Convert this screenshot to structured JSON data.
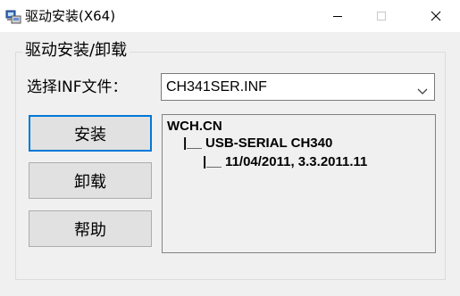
{
  "window": {
    "title": "驱动安装(X64)",
    "app_icon": "computer-setup-icon",
    "controls": [
      "minimize-icon",
      "maximize-icon",
      "close-icon"
    ]
  },
  "group": {
    "title": "驱动安装/卸载"
  },
  "inf_selector": {
    "label": "选择INF文件：",
    "value": "CH341SER.INF",
    "icon": "chevron-down-icon"
  },
  "buttons": {
    "install": "安装",
    "uninstall": "卸载",
    "help": "帮助"
  },
  "driver_info": {
    "vendor": "WCH.CN",
    "device": "|__ USB-SERIAL CH340",
    "version": "|__ 11/04/2011, 3.3.2011.11"
  },
  "colors": {
    "accent": "#0078d7",
    "background": "#f0f0f0"
  }
}
